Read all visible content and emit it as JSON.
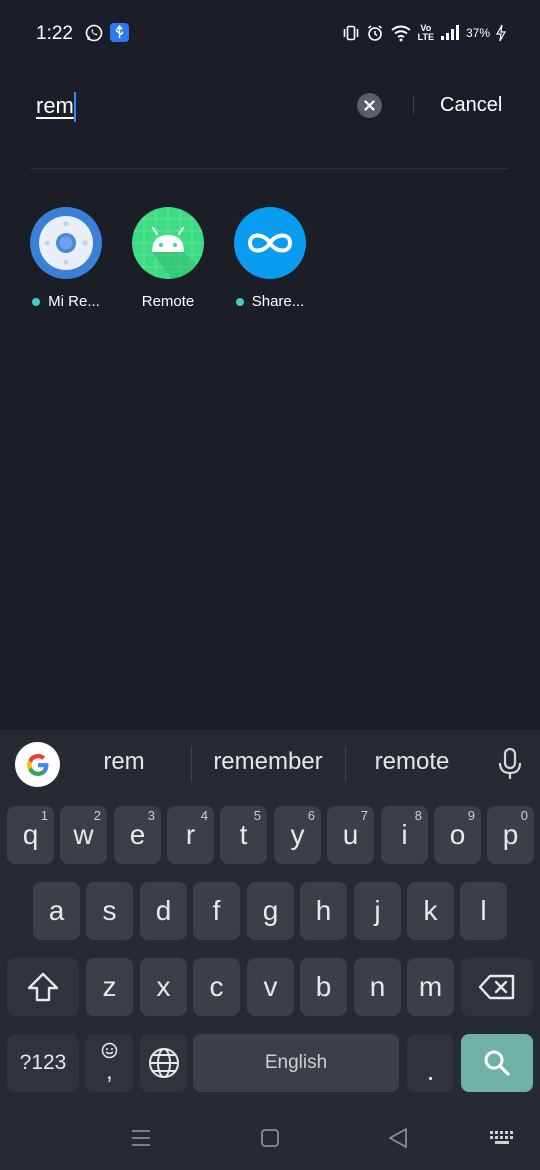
{
  "status_bar": {
    "time": "1:22",
    "battery": "37%",
    "network_label_top": "Vo",
    "network_label_bottom": "LTE"
  },
  "search": {
    "query": "rem",
    "cancel_label": "Cancel"
  },
  "results": [
    {
      "label": "Mi Re...",
      "icon": "mi-remote-icon",
      "new_dot": true
    },
    {
      "label": "Remote",
      "icon": "android-icon",
      "new_dot": false
    },
    {
      "label": "Share...",
      "icon": "share-infinity-icon",
      "new_dot": true
    }
  ],
  "keyboard": {
    "suggestions": [
      "rem",
      "remember",
      "remote"
    ],
    "row1": [
      {
        "key": "q",
        "hint": "1"
      },
      {
        "key": "w",
        "hint": "2"
      },
      {
        "key": "e",
        "hint": "3"
      },
      {
        "key": "r",
        "hint": "4"
      },
      {
        "key": "t",
        "hint": "5"
      },
      {
        "key": "y",
        "hint": "6"
      },
      {
        "key": "u",
        "hint": "7"
      },
      {
        "key": "i",
        "hint": "8"
      },
      {
        "key": "o",
        "hint": "9"
      },
      {
        "key": "p",
        "hint": "0"
      }
    ],
    "row2": [
      "a",
      "s",
      "d",
      "f",
      "g",
      "h",
      "j",
      "k",
      "l"
    ],
    "row3": [
      "z",
      "x",
      "c",
      "v",
      "b",
      "n",
      "m"
    ],
    "symbols_label": "?123",
    "comma_label": ",",
    "space_label": "English",
    "period_label": ".",
    "accent_color": "#6fb1a4"
  }
}
